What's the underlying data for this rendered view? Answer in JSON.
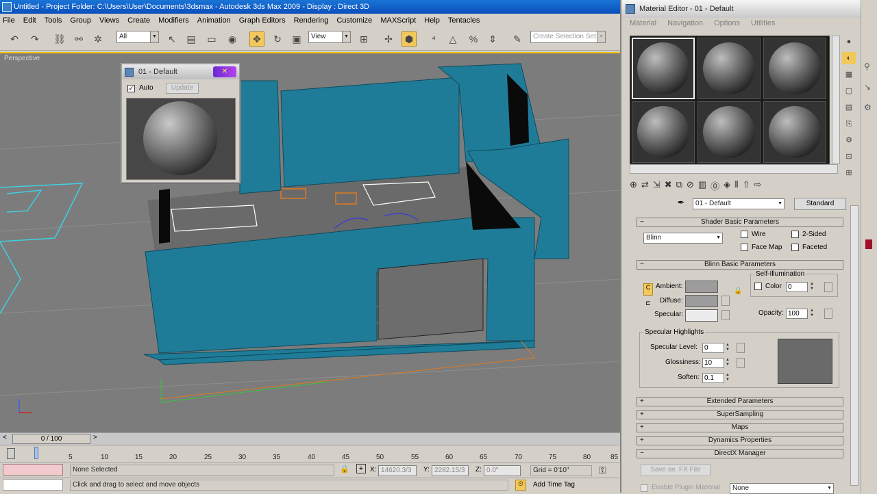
{
  "main_window": {
    "title": "Untitled     - Project Folder: C:\\Users\\User\\Documents\\3dsmax     - Autodesk 3ds Max  2009     - Display : Direct 3D"
  },
  "menu": [
    "File",
    "Edit",
    "Tools",
    "Group",
    "Views",
    "Create",
    "Modifiers",
    "Animation",
    "Graph Editors",
    "Rendering",
    "Customize",
    "MAXScript",
    "Help",
    "Tentacles"
  ],
  "toolbar": {
    "selection_filter": "All",
    "reference_coord": "View",
    "selection_set_placeholder": "Create Selection Set"
  },
  "viewport": {
    "label": "Perspective",
    "mesh_color": "#1f7c99"
  },
  "mat_preview": {
    "title": "01 - Default",
    "auto_label": "Auto",
    "auto_checked": true,
    "update_label": "Update"
  },
  "time": {
    "slider_label": "0 / 100",
    "ticks": [
      "5",
      "10",
      "15",
      "20",
      "25",
      "30",
      "35",
      "40",
      "45",
      "50",
      "55",
      "60",
      "65",
      "70",
      "75",
      "80",
      "85"
    ]
  },
  "status": {
    "selection": "None Selected",
    "hint": "Click and drag to select and move objects",
    "x_label": "X:",
    "x_value": "14620.3/3",
    "y_label": "Y:",
    "y_value": "2282.15/3",
    "z_label": "Z:",
    "z_value": "0.0\"",
    "grid": "Grid = 0'10\"",
    "add_time_tag": "Add Time Tag"
  },
  "material_editor": {
    "title": "Material Editor - 01 - Default",
    "menu": [
      "Material",
      "Navigation",
      "Options",
      "Utilities"
    ],
    "material_name": "01 - Default",
    "material_type": "Standard",
    "shader_rollout": "Shader Basic Parameters",
    "shader": "Blinn",
    "wire": "Wire",
    "two_sided": "2-Sided",
    "face_map": "Face Map",
    "faceted": "Faceted",
    "blinn_rollout": "Blinn Basic Parameters",
    "self_illum": "Self-Illumination",
    "color_label": "Color",
    "color_value": "0",
    "ambient": "Ambient:",
    "diffuse": "Diffuse:",
    "specular": "Specular:",
    "opacity_label": "Opacity:",
    "opacity_value": "100",
    "spec_highlights": "Specular Highlights",
    "spec_level_label": "Specular Level:",
    "spec_level_value": "0",
    "glossiness_label": "Glossiness:",
    "glossiness_value": "10",
    "soften_label": "Soften:",
    "soften_value": "0.1",
    "rollouts": [
      "Extended Parameters",
      "SuperSampling",
      "Maps",
      "Dynamics Properties"
    ],
    "directx_rollout": "DirectX Manager",
    "save_fx": "Save as .FX File",
    "enable_plugin": "Enable Plugin Material",
    "plugin_value": "None"
  }
}
